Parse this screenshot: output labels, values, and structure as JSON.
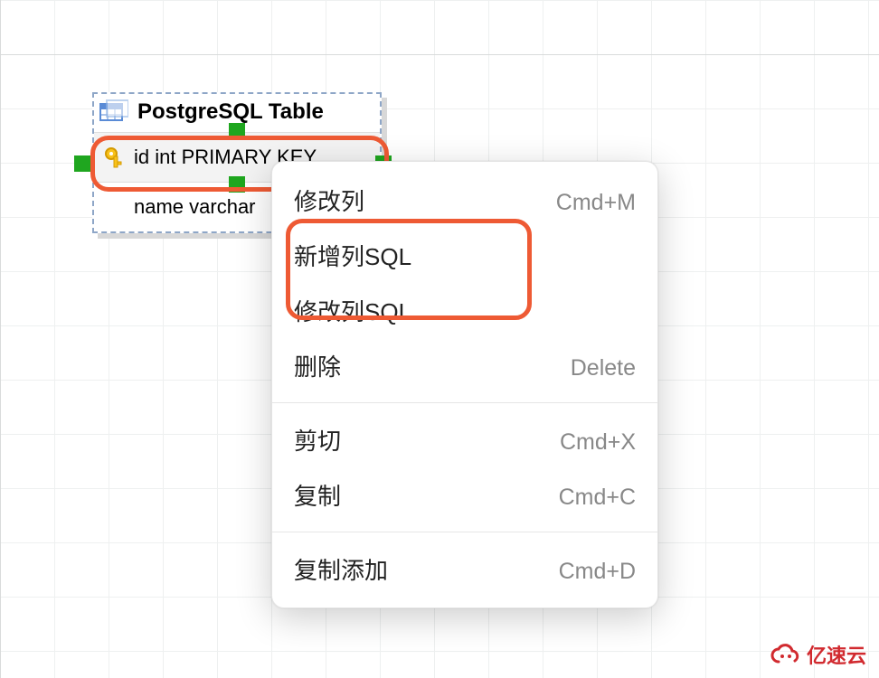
{
  "table": {
    "title": "PostgreSQL Table",
    "rows": [
      {
        "label": "id int PRIMARY KEY",
        "pk": true
      },
      {
        "label": "name varchar"
      }
    ]
  },
  "menu": {
    "items": [
      {
        "label": "修改列",
        "shortcut": "Cmd+M"
      },
      {
        "label": "新增列SQL",
        "shortcut": ""
      },
      {
        "label": "修改列SQL",
        "shortcut": ""
      },
      {
        "label": "删除",
        "shortcut": "Delete"
      }
    ],
    "items2": [
      {
        "label": "剪切",
        "shortcut": "Cmd+X"
      },
      {
        "label": "复制",
        "shortcut": "Cmd+C"
      }
    ],
    "items3": [
      {
        "label": "复制添加",
        "shortcut": "Cmd+D"
      }
    ]
  },
  "watermark": {
    "text": "亿速云"
  },
  "highlights": {
    "selected_row_index": 0,
    "menu_highlight_indices": [
      1,
      2
    ]
  }
}
